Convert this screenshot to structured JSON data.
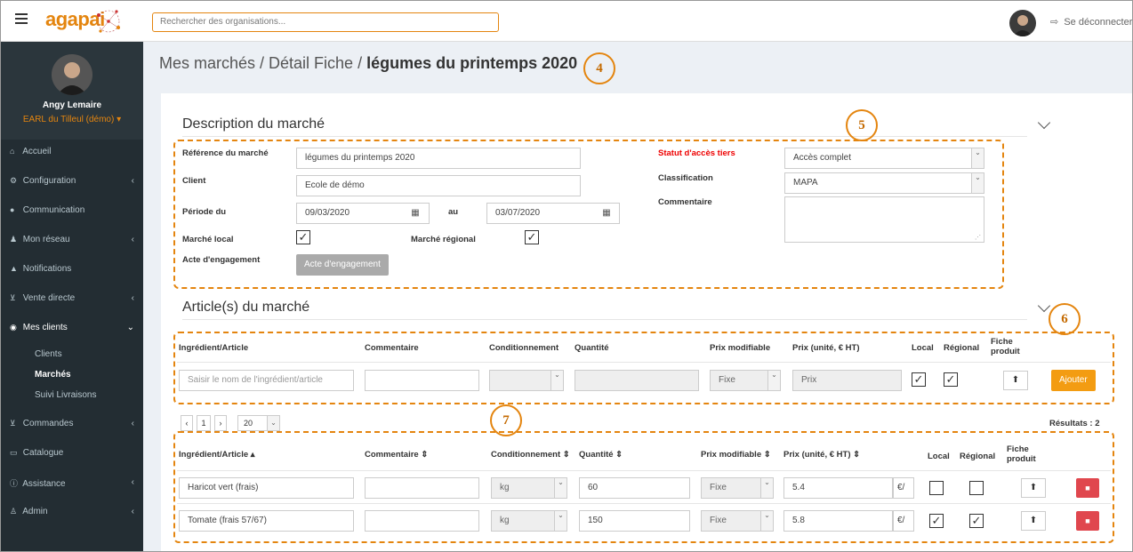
{
  "header": {
    "logo": "agapai",
    "search_placeholder": "Rechercher des organisations...",
    "logout_label": "Se déconnecter",
    "logout_icon": "sign-out-icon"
  },
  "sidebar": {
    "user_name": "Angy Lemaire",
    "org": "EARL du Tilleul (démo)",
    "items": [
      {
        "label": "Accueil",
        "icon": "home-icon",
        "chevron": false
      },
      {
        "label": "Configuration",
        "icon": "cogs-icon",
        "chevron": true
      },
      {
        "label": "Communication",
        "icon": "comments-icon",
        "chevron": false
      },
      {
        "label": "Mon réseau",
        "icon": "users-icon",
        "chevron": true
      },
      {
        "label": "Notifications",
        "icon": "bell-icon",
        "chevron": false
      },
      {
        "label": "Vente directe",
        "icon": "cart-icon",
        "chevron": true
      },
      {
        "label": "Mes clients",
        "icon": "eye-icon",
        "chevron": true
      },
      {
        "label": "Commandes",
        "icon": "cart-icon",
        "chevron": true
      },
      {
        "label": "Catalogue",
        "icon": "book-icon",
        "chevron": false
      },
      {
        "label": "Assistance",
        "icon": "info-icon",
        "chevron": true
      },
      {
        "label": "Admin",
        "icon": "user-plus-icon",
        "chevron": true
      }
    ],
    "sub_items": [
      "Clients",
      "Marchés",
      "Suivi Livraisons"
    ]
  },
  "breadcrumb": {
    "part1": "Mes marchés / Détail Fiche / ",
    "current": "légumes du printemps 2020"
  },
  "callouts": [
    "4",
    "5",
    "6",
    "7"
  ],
  "description": {
    "title": "Description du marché",
    "ref_label": "Référence du marché",
    "ref_value": "légumes du printemps 2020",
    "client_label": "Client",
    "client_value": "Ecole de démo",
    "period_label": "Période du",
    "period_from": "09/03/2020",
    "period_to_label": "au",
    "period_to": "03/07/2020",
    "local_label": "Marché local",
    "local_checked": true,
    "regional_label": "Marché régional",
    "regional_checked": true,
    "acte_label": "Acte d'engagement",
    "acte_button": "Acte d'engagement",
    "statut_label": "Statut d'accès tiers",
    "statut_value": "Accès complet",
    "classification_label": "Classification",
    "classification_value": "MAPA",
    "commentaire_label": "Commentaire"
  },
  "articles": {
    "title": "Article(s) du marché",
    "headers": {
      "ingredient": "Ingrédient/Article",
      "commentaire": "Commentaire",
      "conditionnement": "Conditionnement",
      "quantite": "Quantité",
      "prix_modifiable": "Prix modifiable",
      "prix": "Prix (unité, € HT)",
      "local": "Local",
      "regional": "Régional",
      "fiche": "Fiche produit"
    },
    "new_row": {
      "ingredient_placeholder": "Saisir le nom de l'ingrédient/article",
      "prix_modifiable": "Fixe",
      "prix_placeholder": "Prix",
      "local_checked": true,
      "regional_checked": true,
      "add_button": "Ajouter"
    },
    "pagination": {
      "prev": "‹",
      "page": "1",
      "next": "›",
      "page_size": "20"
    },
    "results": "Résultats : 2",
    "sorted_headers": {
      "ingredient": "Ingrédient/Article ▴",
      "commentaire": "Commentaire ⇕",
      "conditionnement": "Conditionnement ⇕",
      "quantite": "Quantité ⇕",
      "prix_modifiable": "Prix modifiable ⇕",
      "prix": "Prix (unité, € HT) ⇕"
    },
    "rows": [
      {
        "ingredient": "Haricot vert (frais)",
        "commentaire": "",
        "conditionnement": "kg",
        "quantite": "60",
        "prix_modifiable": "Fixe",
        "prix": "5.4",
        "currency": "€/",
        "local": false,
        "regional": false
      },
      {
        "ingredient": "Tomate (frais  57/67)",
        "commentaire": "",
        "conditionnement": "kg",
        "quantite": "150",
        "prix_modifiable": "Fixe",
        "prix": "5.8",
        "currency": "€/",
        "local": true,
        "regional": true
      }
    ]
  }
}
